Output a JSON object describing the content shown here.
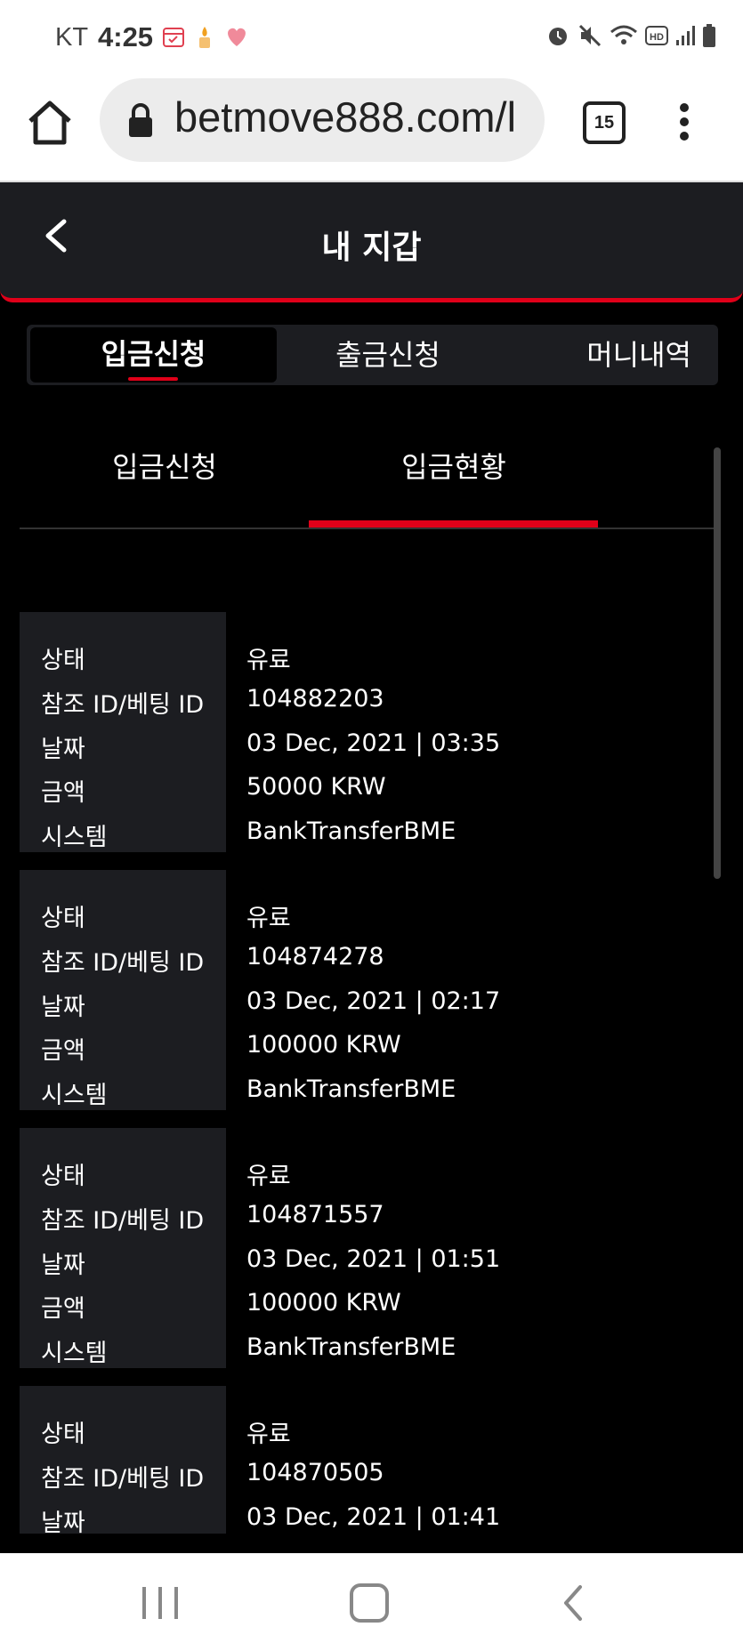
{
  "status_bar": {
    "carrier": "KT",
    "time": "4:25",
    "left_icons": [
      "calendar-icon",
      "candle-icon",
      "heart-icon"
    ],
    "right_icons": [
      "alarm-icon",
      "mute-icon",
      "wifi-icon",
      "hd-icon",
      "signal-icon",
      "battery-icon"
    ]
  },
  "browser": {
    "url": "betmove888.com/l",
    "tab_count": "15"
  },
  "header": {
    "title": "내 지갑"
  },
  "main_tabs": [
    {
      "label": "입금신청",
      "active": true
    },
    {
      "label": "출금신청",
      "active": false
    },
    {
      "label": "머니내역",
      "active": false
    }
  ],
  "sub_tabs": [
    {
      "label": "입금신청",
      "active": false
    },
    {
      "label": "입금현황",
      "active": true
    }
  ],
  "record_labels": {
    "status": "상태",
    "ref": "참조 ID/베팅 ID",
    "date": "날짜",
    "amount": "금액",
    "system": "시스템"
  },
  "records": [
    {
      "status": "유료",
      "ref": "104882203",
      "date": "03 Dec, 2021 | 03:35",
      "amount": "50000 KRW",
      "system": "BankTransferBME"
    },
    {
      "status": "유료",
      "ref": "104874278",
      "date": "03 Dec, 2021 | 02:17",
      "amount": "100000 KRW",
      "system": "BankTransferBME"
    },
    {
      "status": "유료",
      "ref": "104871557",
      "date": "03 Dec, 2021 | 01:51",
      "amount": "100000 KRW",
      "system": "BankTransferBME"
    },
    {
      "status": "유료",
      "ref": "104870505",
      "date": "03 Dec, 2021 | 01:41",
      "amount": "",
      "system": ""
    }
  ],
  "colors": {
    "accent": "#e00019",
    "panel": "#1c1d21",
    "background": "#000000"
  }
}
